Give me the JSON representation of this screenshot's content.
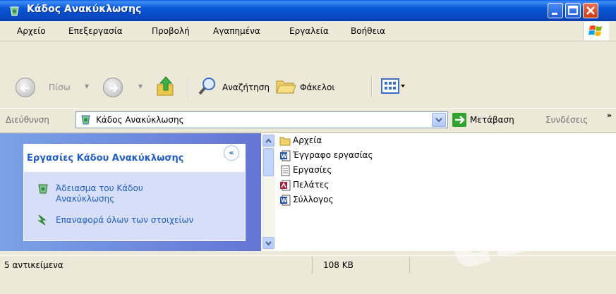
{
  "window": {
    "title": "Κάδος Ανακύκλωσης",
    "buttons": [
      "minimize",
      "maximize",
      "close"
    ]
  },
  "menubar": {
    "items": [
      "Αρχείο",
      "Επεξεργασία",
      "Προβολή",
      "Αγαπημένα",
      "Εργαλεία",
      "Βοήθεια"
    ]
  },
  "toolbar": {
    "back_label": "Πίσω",
    "search_label": "Αναζήτηση",
    "folders_label": "Φάκελοι"
  },
  "address": {
    "label": "Διεύθυνση",
    "value": "Κάδος Ανακύκλωσης",
    "go_label": "Μετάβαση",
    "links_label": "Συνδέσεις",
    "chevron": "»"
  },
  "tasks": {
    "title": "Εργασίες Κάδου Ανακύκλωσης",
    "collapse": "«",
    "items": [
      "Άδειασμα του Κάδου Ανακύκλωσης",
      "Επαναφορά όλων των στοιχείων"
    ]
  },
  "files": [
    {
      "name": "Αρχεία",
      "icon": "folder-icon"
    },
    {
      "name": "Έγγραφο εργασίας",
      "icon": "word-document-icon"
    },
    {
      "name": "Εργασίες",
      "icon": "text-document-icon"
    },
    {
      "name": "Πελάτες",
      "icon": "access-database-icon"
    },
    {
      "name": "Σύλλογος",
      "icon": "word-document-icon"
    }
  ],
  "status": {
    "count": "5 αντικείμενα",
    "size": "108 KB"
  },
  "watermark": "ts.g"
}
